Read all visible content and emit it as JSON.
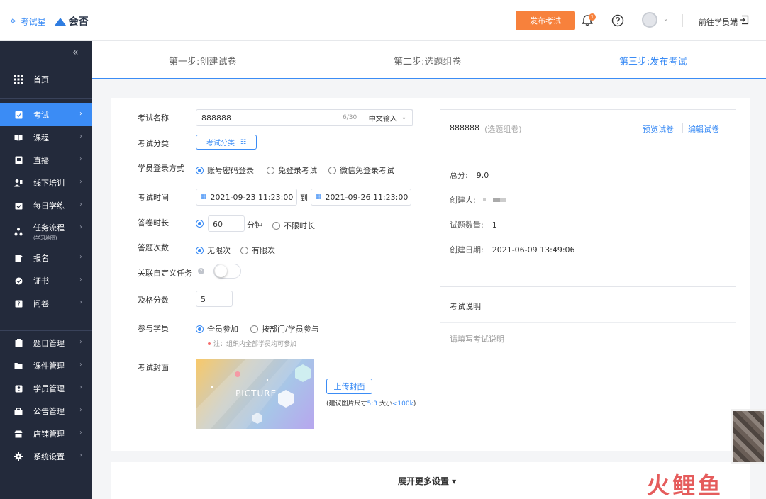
{
  "header": {
    "brand1": "考试星",
    "brand2": "会否",
    "publish_label": "发布考试",
    "bell_badge": "1",
    "goto_student": "前往学员端"
  },
  "sidebar": {
    "collapse_glyph": "«",
    "home": "首页",
    "group1": [
      {
        "label": "考试",
        "icon": "exam-icon",
        "active": true
      },
      {
        "label": "课程",
        "icon": "book-icon"
      },
      {
        "label": "直播",
        "icon": "live-icon"
      },
      {
        "label": "线下培训",
        "icon": "training-icon"
      },
      {
        "label": "每日学练",
        "icon": "calendar-icon"
      },
      {
        "label": "任务流程",
        "sub": "(学习地图)",
        "icon": "flow-icon"
      },
      {
        "label": "报名",
        "icon": "edit-icon"
      },
      {
        "label": "证书",
        "icon": "certificate-icon"
      },
      {
        "label": "问卷",
        "icon": "survey-icon"
      }
    ],
    "group2": [
      {
        "label": "题目管理",
        "icon": "question-icon"
      },
      {
        "label": "课件管理",
        "icon": "folder-icon"
      },
      {
        "label": "学员管理",
        "icon": "user-icon"
      },
      {
        "label": "公告管理",
        "icon": "notice-icon"
      },
      {
        "label": "店铺管理",
        "icon": "store-icon"
      },
      {
        "label": "系统设置",
        "icon": "gear-icon"
      }
    ]
  },
  "steps": [
    "第一步:创建试卷",
    "第二步:选题组卷",
    "第三步:发布考试"
  ],
  "form": {
    "name_label": "考试名称",
    "name_value": "888888",
    "name_count": "6/30",
    "ime_label": "中文输入",
    "category_label": "考试分类",
    "category_btn": "考试分类",
    "login_label": "学员登录方式",
    "login_options": [
      "账号密码登录",
      "免登录考试",
      "微信免登录考试"
    ],
    "time_label": "考试时间",
    "time_start": "2021-09-23 11:23:00",
    "time_to": "到",
    "time_end": "2021-09-26 11:23:00",
    "duration_label": "答卷时长",
    "duration_value": "60",
    "duration_unit": "分钟",
    "duration_unlimited": "不限时长",
    "attempts_label": "答题次数",
    "attempts_options": [
      "无限次",
      "有限次"
    ],
    "custom_task_label": "关联自定义任务",
    "pass_label": "及格分数",
    "pass_value": "5",
    "participants_label": "参与学员",
    "participants_options": [
      "全员参加",
      "按部门/学员参与"
    ],
    "participants_note": "注：组织内全部学员均可参加",
    "cover_label": "考试封面",
    "cover_text": "PICTURE",
    "upload_btn": "上传封面",
    "upload_hint_prefix": "(建议图片尺寸",
    "upload_hint_ratio": "5:3",
    "upload_hint_mid": " 大小",
    "upload_hint_size": "<100k",
    "upload_hint_suffix": ")"
  },
  "paper": {
    "title": "888888",
    "subtitle": "(选题组卷)",
    "preview": "预览试卷",
    "edit": "编辑试卷",
    "total_label": "总分:",
    "total_value": "9.0",
    "creator_label": "创建人:",
    "count_label": "试题数量:",
    "count_value": "1",
    "date_label": "创建日期:",
    "date_value": "2021-06-09 13:49:06"
  },
  "desc": {
    "title": "考试说明",
    "placeholder": "请填写考试说明"
  },
  "more": "展开更多设置 ▾",
  "watermark": "火鲤鱼"
}
